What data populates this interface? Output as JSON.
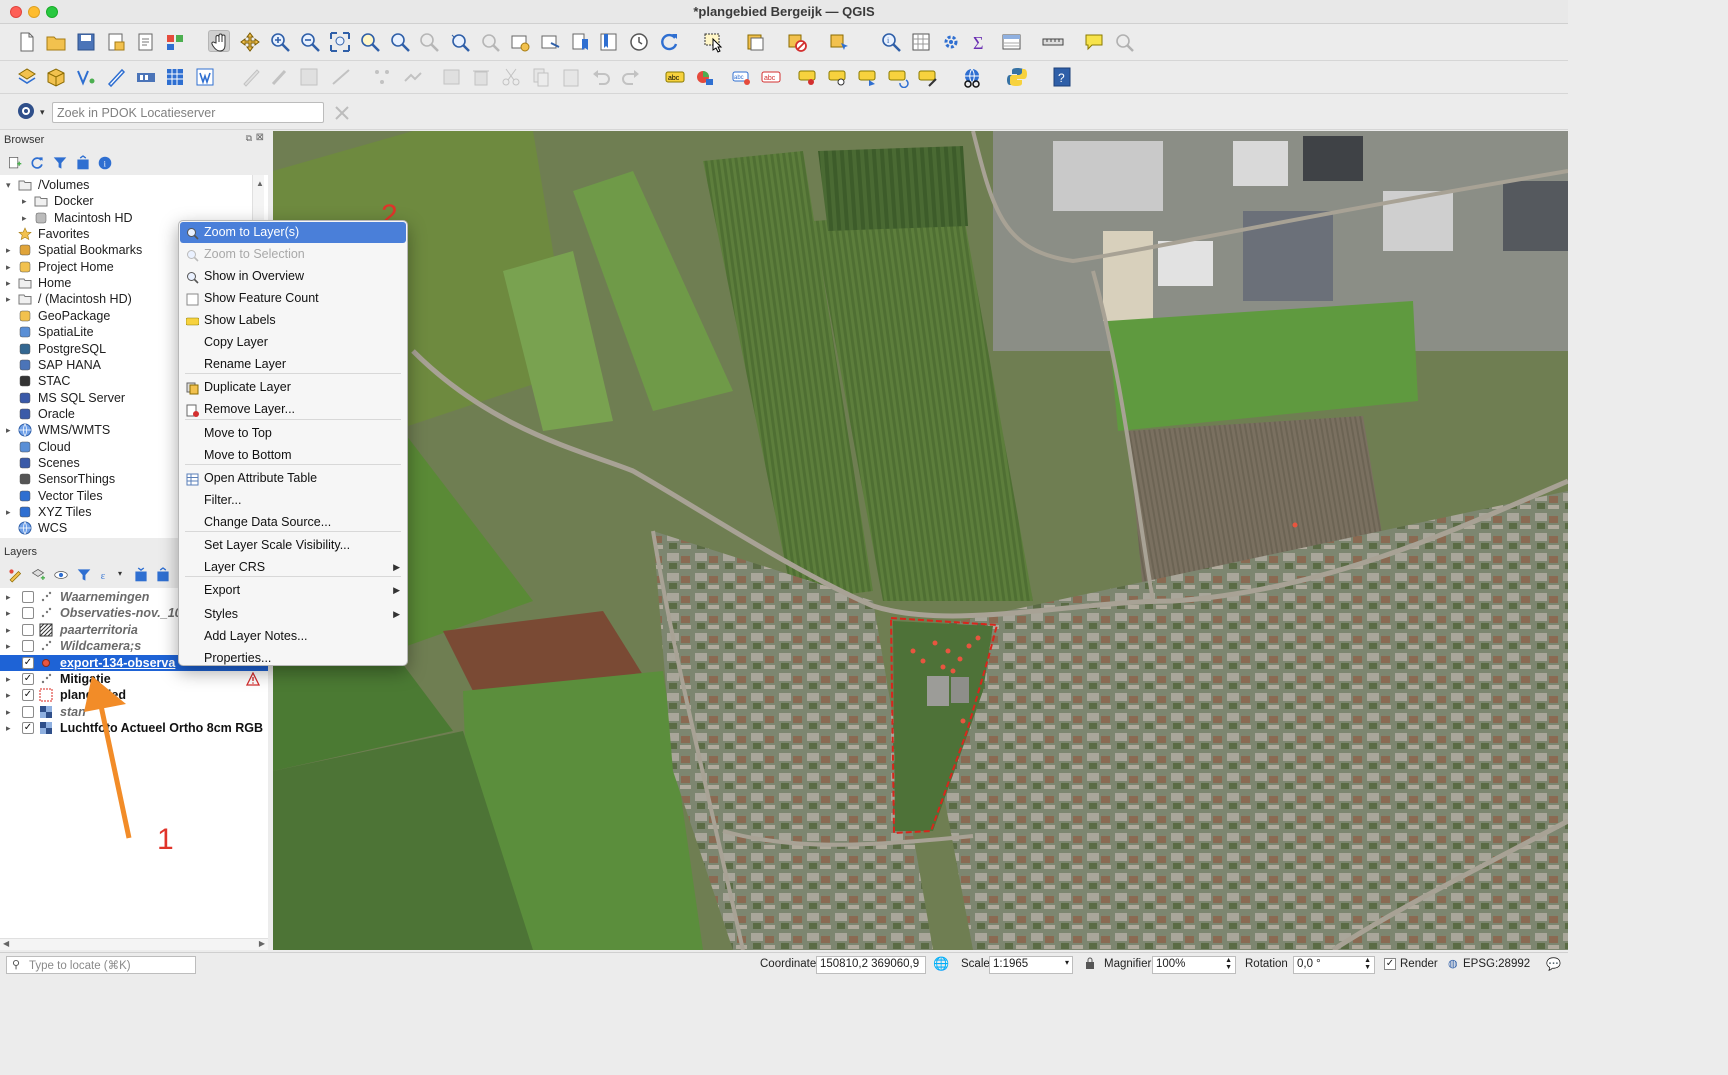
{
  "window": {
    "title": "*plangebied Bergeijk — QGIS"
  },
  "search": {
    "placeholder": "Zoek in PDOK Locatieserver"
  },
  "browser": {
    "title": "Browser",
    "items": [
      {
        "label": "/Volumes",
        "icon": "folder-icon",
        "expanded": true
      },
      {
        "label": "Docker",
        "icon": "folder-icon"
      },
      {
        "label": "Macintosh HD",
        "icon": "drive-icon"
      },
      {
        "label": "Favorites",
        "icon": "star-icon"
      },
      {
        "label": "Spatial Bookmarks",
        "icon": "bookmark-icon"
      },
      {
        "label": "Project Home",
        "icon": "project-home-icon"
      },
      {
        "label": "Home",
        "icon": "folder-icon"
      },
      {
        "label": "/ (Macintosh HD)",
        "icon": "folder-icon"
      },
      {
        "label": "GeoPackage",
        "icon": "geopackage-icon"
      },
      {
        "label": "SpatiaLite",
        "icon": "spatialite-icon"
      },
      {
        "label": "PostgreSQL",
        "icon": "postgresql-icon"
      },
      {
        "label": "SAP HANA",
        "icon": "database-icon"
      },
      {
        "label": "STAC",
        "icon": "stac-icon"
      },
      {
        "label": "MS SQL Server",
        "icon": "mssql-icon"
      },
      {
        "label": "Oracle",
        "icon": "oracle-icon"
      },
      {
        "label": "WMS/WMTS",
        "icon": "globe-icon"
      },
      {
        "label": "Cloud",
        "icon": "cloud-icon"
      },
      {
        "label": "Scenes",
        "icon": "scenes-icon"
      },
      {
        "label": "SensorThings",
        "icon": "sensor-icon"
      },
      {
        "label": "Vector Tiles",
        "icon": "vector-tiles-icon"
      },
      {
        "label": "XYZ Tiles",
        "icon": "xyz-tiles-icon"
      },
      {
        "label": "WCS",
        "icon": "globe-icon"
      }
    ]
  },
  "layers": {
    "title": "Layers",
    "items": [
      {
        "label": "Waarnemingen",
        "checked": false,
        "style": "italic"
      },
      {
        "label": "Observaties-nov._10",
        "checked": false,
        "style": "italic"
      },
      {
        "label": "paarterritoria",
        "checked": false,
        "style": "italic"
      },
      {
        "label": "Wildcamera;s",
        "checked": false,
        "style": "italic"
      },
      {
        "label": "export-134-observa",
        "checked": true,
        "style": "selected"
      },
      {
        "label": "Mitigatie",
        "checked": true,
        "style": "bold"
      },
      {
        "label": "plangebied",
        "checked": true,
        "style": "bold"
      },
      {
        "label": "stan",
        "checked": false,
        "style": "italic"
      },
      {
        "label": "Luchtfoto Actueel Ortho 8cm RGB",
        "checked": true,
        "style": "bold"
      }
    ]
  },
  "context_menu": {
    "items": [
      {
        "label": "Zoom to Layer(s)",
        "state": "active",
        "icon": "zoom-layer-icon"
      },
      {
        "label": "Zoom to Selection",
        "state": "disabled",
        "icon": "zoom-selection-icon"
      },
      {
        "label": "Show in Overview",
        "icon": "overview-icon"
      },
      {
        "label": "Show Feature Count",
        "icon": "checkbox-icon"
      },
      {
        "label": "Show Labels",
        "icon": "labels-icon"
      },
      {
        "label": "Copy Layer"
      },
      {
        "label": "Rename Layer"
      },
      {
        "label": "Duplicate Layer",
        "icon": "duplicate-icon"
      },
      {
        "label": "Remove Layer...",
        "icon": "remove-layer-icon"
      },
      {
        "label": "Move to Top"
      },
      {
        "label": "Move to Bottom"
      },
      {
        "label": "Open Attribute Table",
        "icon": "table-icon"
      },
      {
        "label": "Filter..."
      },
      {
        "label": "Change Data Source..."
      },
      {
        "label": "Set Layer Scale Visibility..."
      },
      {
        "label": "Layer CRS",
        "submenu": true
      },
      {
        "label": "Export",
        "submenu": true
      },
      {
        "label": "Styles",
        "submenu": true
      },
      {
        "label": "Add Layer Notes..."
      },
      {
        "label": "Properties..."
      }
    ]
  },
  "annotations": {
    "one": "1",
    "two": "2"
  },
  "status": {
    "locate_placeholder": "Type to locate (⌘K)",
    "coordinate_label": "Coordinate",
    "coordinate_value": "150810,2  369060,9",
    "scale_label": "Scale",
    "scale_value": "1:1965",
    "magnifier_label": "Magnifier",
    "magnifier_value": "100%",
    "rotation_label": "Rotation",
    "rotation_value": "0,0 °",
    "render_label": "Render",
    "render_checked": true,
    "crs_label": "EPSG:28992"
  },
  "colors": {
    "selection": "#1e63d6",
    "menu_active": "#4a7fd9",
    "annotation": "#e0342a",
    "arrow": "#f28c28",
    "plangebied_outline": "#d8261c"
  }
}
